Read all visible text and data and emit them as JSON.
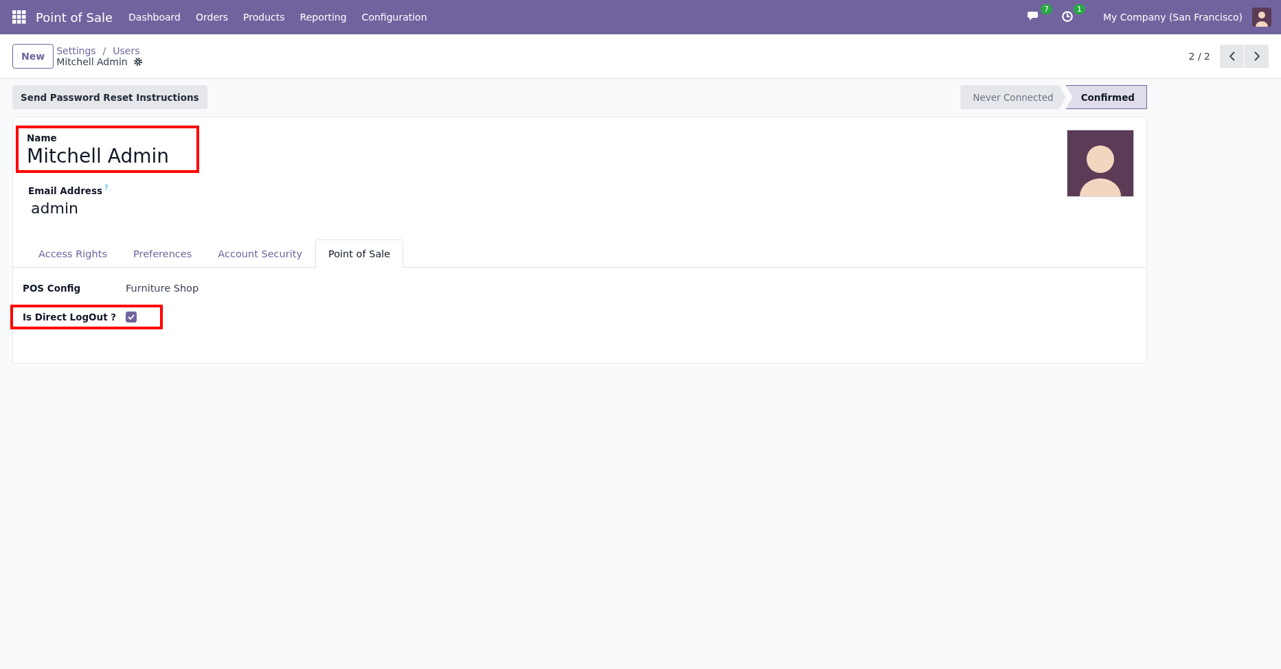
{
  "navbar": {
    "app_name": "Point of Sale",
    "menu": [
      "Dashboard",
      "Orders",
      "Products",
      "Reporting",
      "Configuration"
    ],
    "messages_count": "7",
    "activities_count": "1",
    "company": "My Company (San Francisco)"
  },
  "control_panel": {
    "new_button": "New",
    "breadcrumbs": [
      "Settings",
      "Users"
    ],
    "breadcrumb_separator": "/",
    "record_title": "Mitchell Admin",
    "pager": "2 / 2"
  },
  "header_buttons": [
    "Send Password Reset Instructions"
  ],
  "status_bar": [
    {
      "label": "Never Connected",
      "selected": false
    },
    {
      "label": "Confirmed",
      "selected": true
    }
  ],
  "form": {
    "name_label": "Name",
    "name_value": "Mitchell Admin",
    "name_highlighted": true,
    "email_label": "Email Address",
    "email_help": "?",
    "email_value": "admin"
  },
  "tabs": [
    {
      "label": "Access Rights",
      "selected": false
    },
    {
      "label": "Preferences",
      "selected": false
    },
    {
      "label": "Account Security",
      "selected": false
    },
    {
      "label": "Point of Sale",
      "selected": true
    }
  ],
  "fields": [
    {
      "kind": "text",
      "label": "POS Config",
      "value": "Furniture Shop",
      "highlighted": false
    },
    {
      "kind": "checkbox",
      "label": "Is Direct LogOut ?",
      "checked": true,
      "highlighted": true
    }
  ]
}
